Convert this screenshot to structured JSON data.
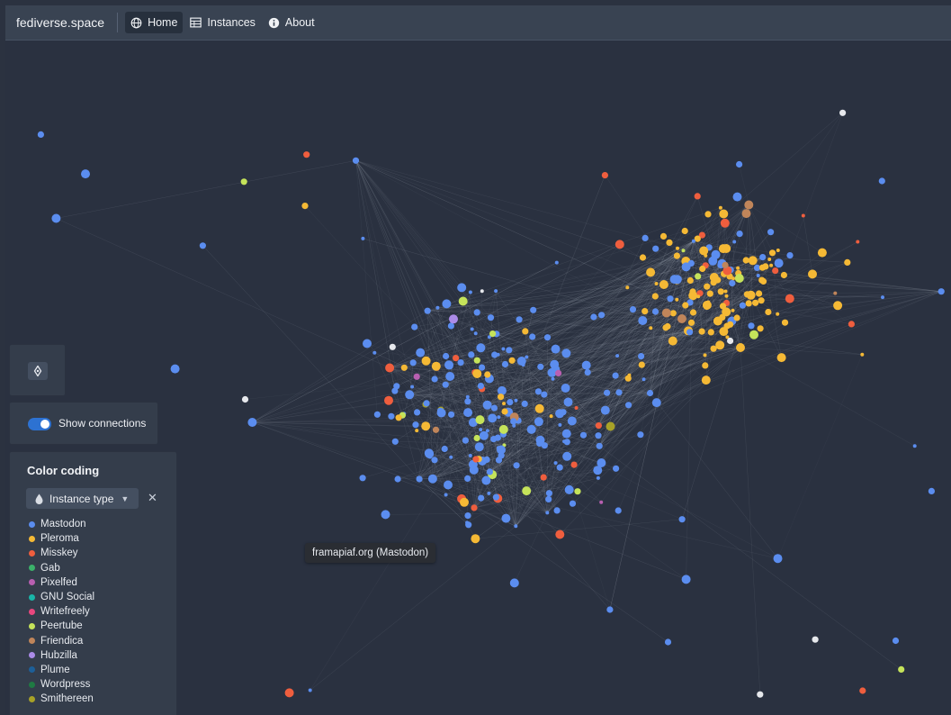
{
  "app": {
    "brand": "fediverse.space"
  },
  "nav": {
    "items": [
      {
        "label": "Home",
        "icon": "globe-icon",
        "active": true
      },
      {
        "label": "Instances",
        "icon": "table-icon",
        "active": false
      },
      {
        "label": "About",
        "icon": "info-icon",
        "active": false
      }
    ]
  },
  "controls": {
    "locate_icon": "locate-icon",
    "show_connections_label": "Show connections",
    "show_connections_enabled": true
  },
  "legend": {
    "title": "Color coding",
    "select_value": "Instance type",
    "select_icon": "drop-icon",
    "clear_icon": "close-icon",
    "items": [
      {
        "label": "Mastodon",
        "color": "#5b8def"
      },
      {
        "label": "Pleroma",
        "color": "#f5b935"
      },
      {
        "label": "Misskey",
        "color": "#ef5e3e"
      },
      {
        "label": "Gab",
        "color": "#3bb16a"
      },
      {
        "label": "Pixelfed",
        "color": "#b85fb1"
      },
      {
        "label": "GNU Social",
        "color": "#19b5a8"
      },
      {
        "label": "Writefreely",
        "color": "#e9477e"
      },
      {
        "label": "Peertube",
        "color": "#c5e35a"
      },
      {
        "label": "Friendica",
        "color": "#c0855a"
      },
      {
        "label": "Hubzilla",
        "color": "#ab8be8"
      },
      {
        "label": "Plume",
        "color": "#1d5f98"
      },
      {
        "label": "Wordpress",
        "color": "#1f7a43"
      },
      {
        "label": "Smithereen",
        "color": "#a8a227"
      }
    ]
  },
  "tooltip": {
    "text": "framapiaf.org (Mastodon)"
  },
  "graph": {
    "colors": {
      "mastodon": "#5b8def",
      "pleroma": "#f5b935",
      "misskey": "#ef5e3e",
      "peertube": "#c5e35a",
      "friendica": "#c0855a",
      "pixelfed": "#b85fb1",
      "hubzilla": "#ab8be8",
      "writefreely": "#e9477e",
      "smithereen": "#a8a227",
      "unknown": "#e6e8ec",
      "edge": "#b8c0cc"
    }
  }
}
